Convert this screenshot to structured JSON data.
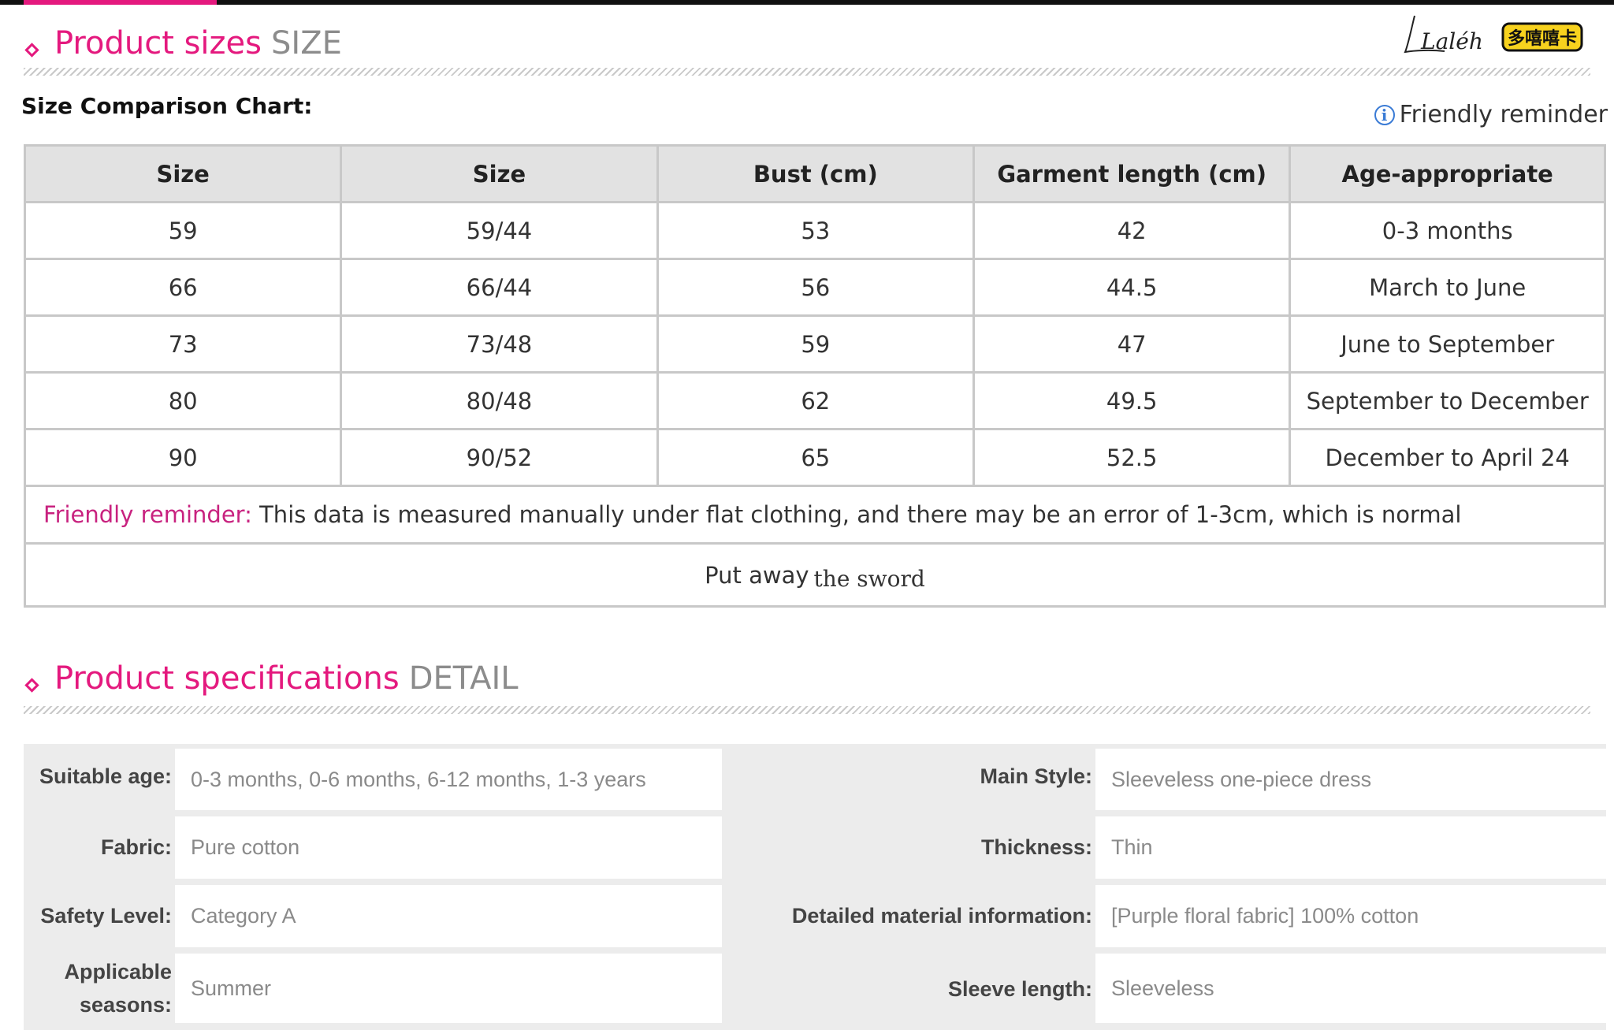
{
  "size_section": {
    "title": "Product sizes",
    "subtitle": "SIZE"
  },
  "logo": {
    "script_text": "Laléh",
    "badge_text": "多嘻嘻卡",
    "colors": {
      "badge_fill": "#f7d21e",
      "badge_stroke": "#111111"
    }
  },
  "chart_label": "Size Comparison Chart:",
  "friendly_reminder_link": "Friendly reminder",
  "table": {
    "headers": [
      "Size",
      "Size",
      "Bust (cm)",
      "Garment length (cm)",
      "Age-appropriate"
    ],
    "rows": [
      [
        "59",
        "59/44",
        "53",
        "42",
        "0-3 months"
      ],
      [
        "66",
        "66/44",
        "56",
        "44.5",
        "March to June"
      ],
      [
        "73",
        "73/48",
        "59",
        "47",
        "June to September"
      ],
      [
        "80",
        "80/48",
        "62",
        "49.5",
        "September to December"
      ],
      [
        "90",
        "90/52",
        "65",
        "52.5",
        "December to April 24"
      ]
    ],
    "note_label": "Friendly reminder:",
    "note_text": " This data is measured manually under flat clothing, and there may be an error of 1-3cm, which is normal",
    "put_away": "Put away",
    "the_sword": "the  sword"
  },
  "spec_section": {
    "title": "Product specifications",
    "subtitle": "DETAIL"
  },
  "specs": {
    "rows": [
      {
        "left_key": "Suitable age:",
        "left_value": "0-3 months, 0-6 months, 6-12 months, 1-3 years",
        "right_key": "Main Style:",
        "right_value": "Sleeveless one-piece dress"
      },
      {
        "left_key": "Fabric:",
        "left_value": "Pure cotton",
        "right_key": "Thickness:",
        "right_value": "Thin"
      },
      {
        "left_key": "Safety Level:",
        "left_value": "Category A",
        "right_key": "Detailed material information:",
        "right_value": "[Purple floral fabric] 100% cotton"
      },
      {
        "left_key": "Applicable seasons:",
        "left_value": "Summer",
        "right_key": "Sleeve length:",
        "right_value": "Sleeveless"
      }
    ]
  },
  "colors": {
    "accent": "#e4197e",
    "note_label": "#c8227f",
    "info_icon": "#3a7bd5"
  },
  "icons": {
    "section_marker": "diamond-icon",
    "info": "info-icon"
  }
}
